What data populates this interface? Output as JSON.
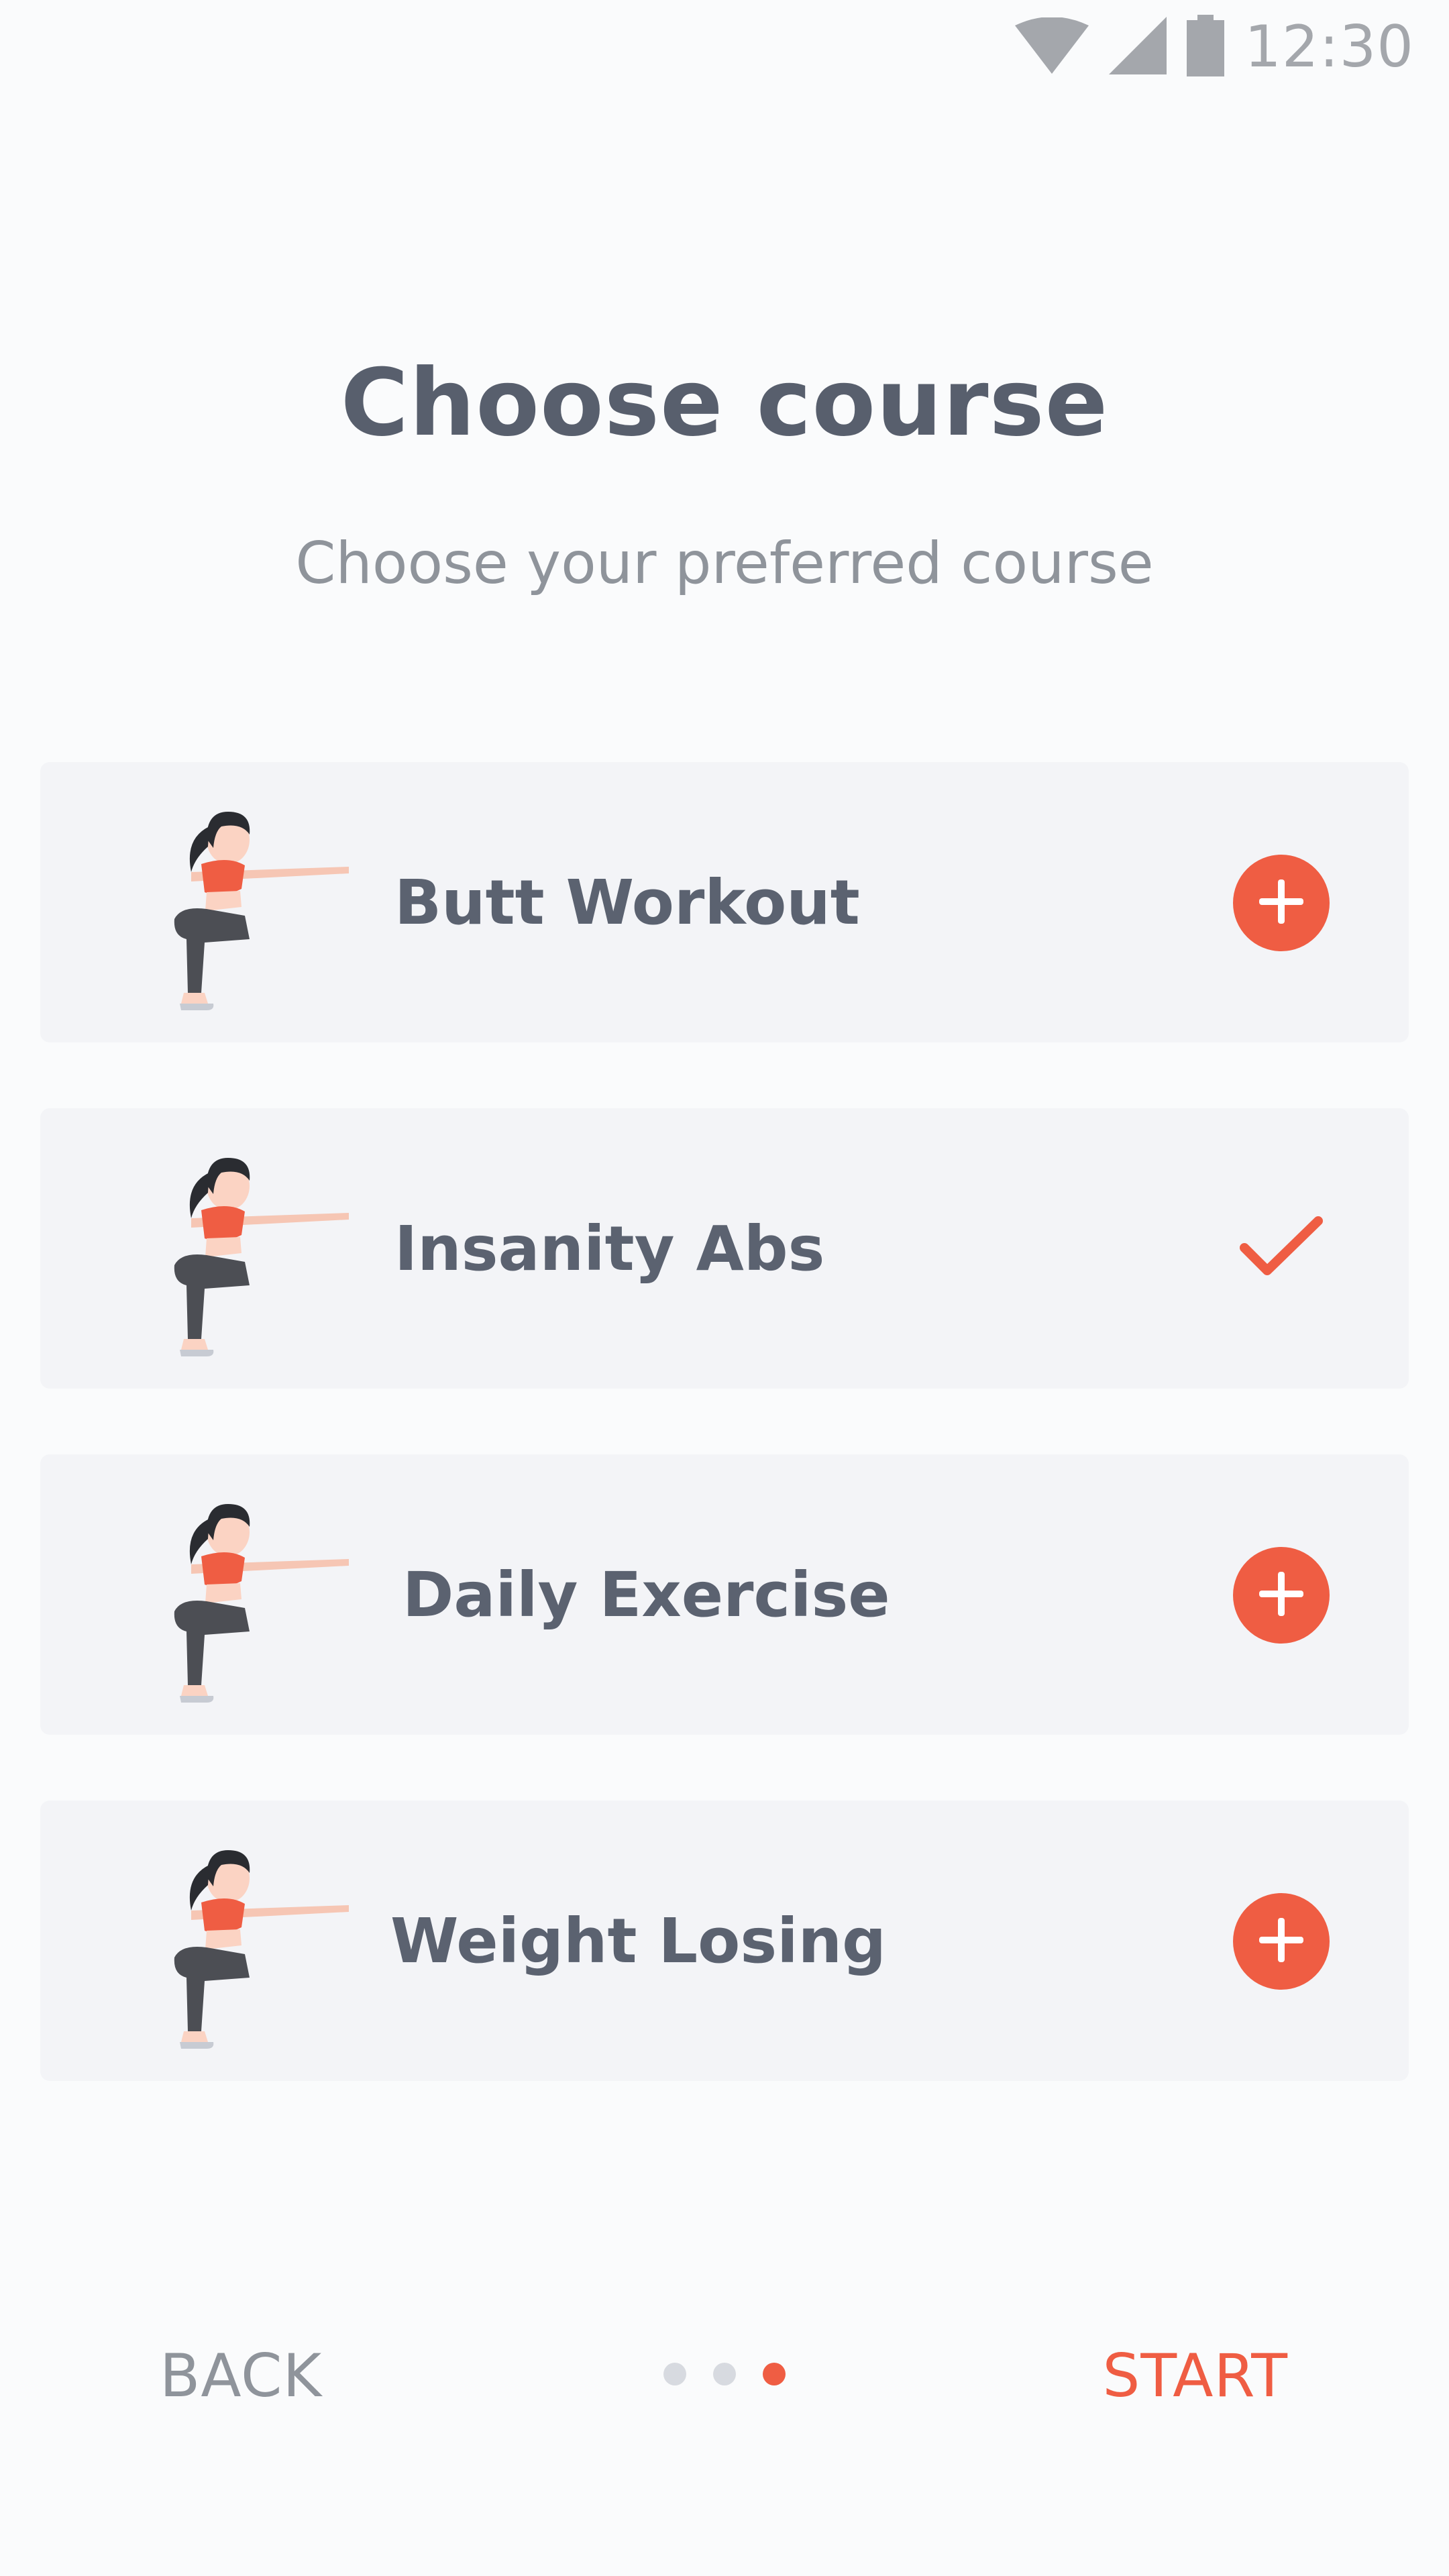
{
  "status_bar": {
    "time": "12:30",
    "icons": [
      "wifi-icon",
      "cellular-signal-icon",
      "battery-icon"
    ]
  },
  "header": {
    "title": "Choose course",
    "subtitle": "Choose your preferred course"
  },
  "courses": [
    {
      "label": "Butt Workout",
      "state": "add",
      "icon": "plus-icon"
    },
    {
      "label": "Insanity Abs",
      "state": "selected",
      "icon": "checkmark-icon"
    },
    {
      "label": "Daily Exercise",
      "state": "add",
      "icon": "plus-icon"
    },
    {
      "label": "Weight Losing",
      "state": "add",
      "icon": "plus-icon"
    }
  ],
  "footer": {
    "back_label": "BACK",
    "start_label": "START",
    "pager": {
      "count": 3,
      "active_index": 2
    }
  },
  "colors": {
    "accent": "#ef5d43",
    "text_primary": "#585f6d",
    "text_secondary": "#8f949b",
    "card_bg": "#f3f4f7"
  }
}
